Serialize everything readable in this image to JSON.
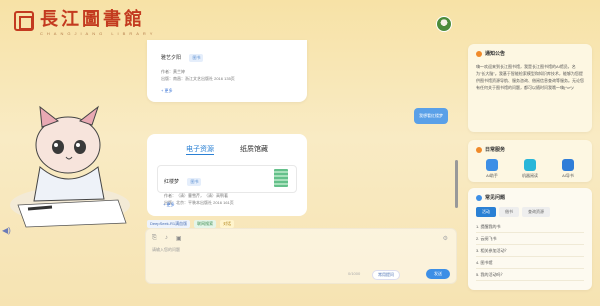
{
  "brand": {
    "title": "長江圖書館",
    "subtitle": "CHANGJIANG LIBRARY"
  },
  "chat": {
    "card1": {
      "book_title": "雅艺夕阳",
      "tag": "图书",
      "author": "作者：黄兰婷",
      "publisher": "出版：南昌：浙江文艺出版社 2016 135页",
      "more": "+ 更多"
    },
    "user_message": "我想看红楼梦",
    "card2": {
      "tabs": [
        "电子资源",
        "纸质馆藏"
      ],
      "book_title": "红楼梦",
      "tag": "图书",
      "author": "作者：（清）曹雪芹，（清）高鹗著",
      "publisher": "出版：北京：平装本出版社 2016 161页",
      "more": "+ 更多"
    },
    "chips": [
      "DeepSeek-R1满血版",
      "联网搜索",
      "对话"
    ],
    "input": {
      "placeholder": "请输入您的问题",
      "counter": "0/1000",
      "hint": "常用提问",
      "send": "发送"
    }
  },
  "sidebar": {
    "notice": {
      "title": "通知公告",
      "text": "嗨～欢迎来到长江图书馆，我是长江图书馆的AI馆员，名为\"长大脑\"。我基于智能检索模型和知识库技术，能够为您提供图书馆资源导航、服务咨询、借阅信息查询等服务。无论您有任何关于图书馆的问题，都可以随时问我哦～嗨(^o^)/"
    },
    "services": {
      "title": "日常服务",
      "items": [
        "AI助手",
        "机器阅读",
        "AI导书"
      ]
    },
    "faq": {
      "title": "常见问题",
      "tabs": [
        "活动",
        "借书",
        "查询资源"
      ],
      "items": [
        "1. 提醒我的书",
        "2. 云阅飞书",
        "3. 相关参加活动？",
        "4. 图书馆",
        "5. 我的活动吗？"
      ]
    }
  }
}
